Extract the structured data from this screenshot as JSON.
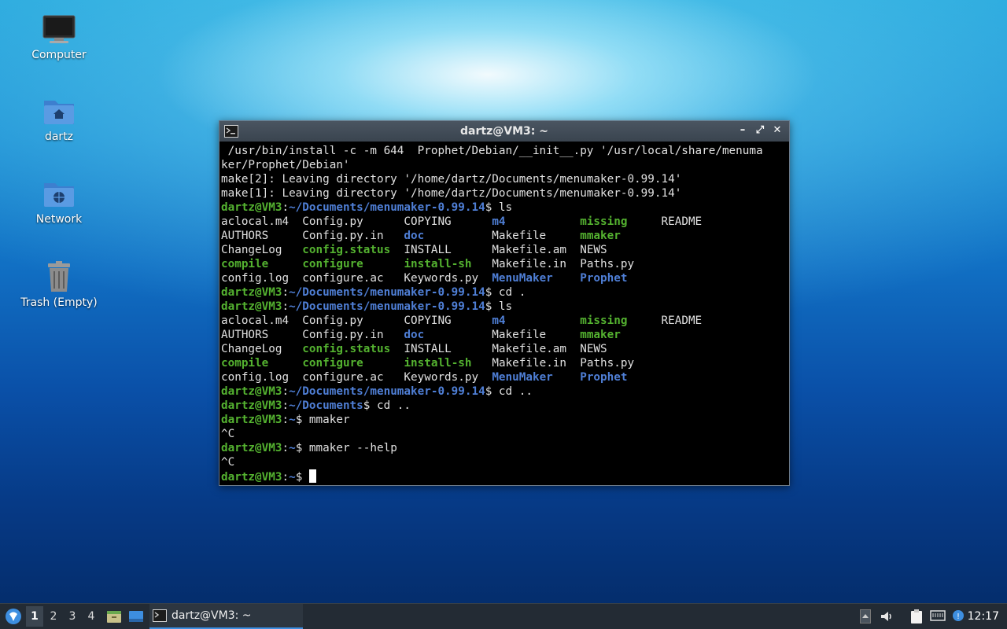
{
  "desktop": {
    "icons": [
      {
        "label": "Computer"
      },
      {
        "label": "dartz"
      },
      {
        "label": "Network"
      },
      {
        "label": "Trash (Empty)"
      }
    ]
  },
  "window": {
    "title": "dartz@VM3: ~",
    "controls": {
      "minimize": "–",
      "maximize": "⤢",
      "close": "✕"
    }
  },
  "terminal": {
    "lines": [
      [
        {
          "t": " /usr/bin/install -c -m 644  Prophet/Debian/__init__.py '/usr/local/share/menuma",
          "c": "w"
        }
      ],
      [
        {
          "t": "ker/Prophet/Debian'",
          "c": "w"
        }
      ],
      [
        {
          "t": "make[2]: Leaving directory '/home/dartz/Documents/menumaker-0.99.14'",
          "c": "w"
        }
      ],
      [
        {
          "t": "make[1]: Leaving directory '/home/dartz/Documents/menumaker-0.99.14'",
          "c": "w"
        }
      ],
      [
        {
          "t": "dartz@VM3",
          "c": "g"
        },
        {
          "t": ":",
          "c": "w"
        },
        {
          "t": "~/Documents/menumaker-0.99.14",
          "c": "b"
        },
        {
          "t": "$ ls",
          "c": "w"
        }
      ],
      [
        {
          "t": "aclocal.m4  Config.py      COPYING      ",
          "c": "w"
        },
        {
          "t": "m4",
          "c": "b"
        },
        {
          "t": "           ",
          "c": "w"
        },
        {
          "t": "missing",
          "c": "g"
        },
        {
          "t": "     README",
          "c": "w"
        }
      ],
      [
        {
          "t": "AUTHORS     Config.py.in   ",
          "c": "w"
        },
        {
          "t": "doc",
          "c": "b"
        },
        {
          "t": "          Makefile     ",
          "c": "w"
        },
        {
          "t": "mmaker",
          "c": "g"
        }
      ],
      [
        {
          "t": "ChangeLog   ",
          "c": "w"
        },
        {
          "t": "config.status",
          "c": "g"
        },
        {
          "t": "  INSTALL      Makefile.am  NEWS",
          "c": "w"
        }
      ],
      [
        {
          "t": "compile",
          "c": "g"
        },
        {
          "t": "     ",
          "c": "w"
        },
        {
          "t": "configure",
          "c": "g"
        },
        {
          "t": "      ",
          "c": "w"
        },
        {
          "t": "install-sh",
          "c": "g"
        },
        {
          "t": "   Makefile.in  Paths.py",
          "c": "w"
        }
      ],
      [
        {
          "t": "config.log  configure.ac   Keywords.py  ",
          "c": "w"
        },
        {
          "t": "MenuMaker",
          "c": "b"
        },
        {
          "t": "    ",
          "c": "w"
        },
        {
          "t": "Prophet",
          "c": "b"
        }
      ],
      [
        {
          "t": "dartz@VM3",
          "c": "g"
        },
        {
          "t": ":",
          "c": "w"
        },
        {
          "t": "~/Documents/menumaker-0.99.14",
          "c": "b"
        },
        {
          "t": "$ cd .",
          "c": "w"
        }
      ],
      [
        {
          "t": "dartz@VM3",
          "c": "g"
        },
        {
          "t": ":",
          "c": "w"
        },
        {
          "t": "~/Documents/menumaker-0.99.14",
          "c": "b"
        },
        {
          "t": "$ ls",
          "c": "w"
        }
      ],
      [
        {
          "t": "aclocal.m4  Config.py      COPYING      ",
          "c": "w"
        },
        {
          "t": "m4",
          "c": "b"
        },
        {
          "t": "           ",
          "c": "w"
        },
        {
          "t": "missing",
          "c": "g"
        },
        {
          "t": "     README",
          "c": "w"
        }
      ],
      [
        {
          "t": "AUTHORS     Config.py.in   ",
          "c": "w"
        },
        {
          "t": "doc",
          "c": "b"
        },
        {
          "t": "          Makefile     ",
          "c": "w"
        },
        {
          "t": "mmaker",
          "c": "g"
        }
      ],
      [
        {
          "t": "ChangeLog   ",
          "c": "w"
        },
        {
          "t": "config.status",
          "c": "g"
        },
        {
          "t": "  INSTALL      Makefile.am  NEWS",
          "c": "w"
        }
      ],
      [
        {
          "t": "compile",
          "c": "g"
        },
        {
          "t": "     ",
          "c": "w"
        },
        {
          "t": "configure",
          "c": "g"
        },
        {
          "t": "      ",
          "c": "w"
        },
        {
          "t": "install-sh",
          "c": "g"
        },
        {
          "t": "   Makefile.in  Paths.py",
          "c": "w"
        }
      ],
      [
        {
          "t": "config.log  configure.ac   Keywords.py  ",
          "c": "w"
        },
        {
          "t": "MenuMaker",
          "c": "b"
        },
        {
          "t": "    ",
          "c": "w"
        },
        {
          "t": "Prophet",
          "c": "b"
        }
      ],
      [
        {
          "t": "dartz@VM3",
          "c": "g"
        },
        {
          "t": ":",
          "c": "w"
        },
        {
          "t": "~/Documents/menumaker-0.99.14",
          "c": "b"
        },
        {
          "t": "$ cd ..",
          "c": "w"
        }
      ],
      [
        {
          "t": "dartz@VM3",
          "c": "g"
        },
        {
          "t": ":",
          "c": "w"
        },
        {
          "t": "~/Documents",
          "c": "b"
        },
        {
          "t": "$ cd ..",
          "c": "w"
        }
      ],
      [
        {
          "t": "dartz@VM3",
          "c": "g"
        },
        {
          "t": ":",
          "c": "w"
        },
        {
          "t": "~",
          "c": "b"
        },
        {
          "t": "$ mmaker",
          "c": "w"
        }
      ],
      [
        {
          "t": "^C",
          "c": "w"
        }
      ],
      [
        {
          "t": "dartz@VM3",
          "c": "g"
        },
        {
          "t": ":",
          "c": "w"
        },
        {
          "t": "~",
          "c": "b"
        },
        {
          "t": "$ mmaker --help",
          "c": "w"
        }
      ],
      [
        {
          "t": "^C",
          "c": "w"
        }
      ],
      [
        {
          "t": "dartz@VM3",
          "c": "g"
        },
        {
          "t": ":",
          "c": "w"
        },
        {
          "t": "~",
          "c": "b"
        },
        {
          "t": "$ ",
          "c": "w"
        }
      ]
    ]
  },
  "taskbar": {
    "workspaces": [
      "1",
      "2",
      "3",
      "4"
    ],
    "active_workspace": "1",
    "task_label": "dartz@VM3: ~",
    "clock": "12:17"
  },
  "colors": {
    "prompt_user": "#54b230",
    "prompt_path": "#4f7fd6",
    "taskbar": "#232b34",
    "task_underline": "#3d8ee0"
  }
}
